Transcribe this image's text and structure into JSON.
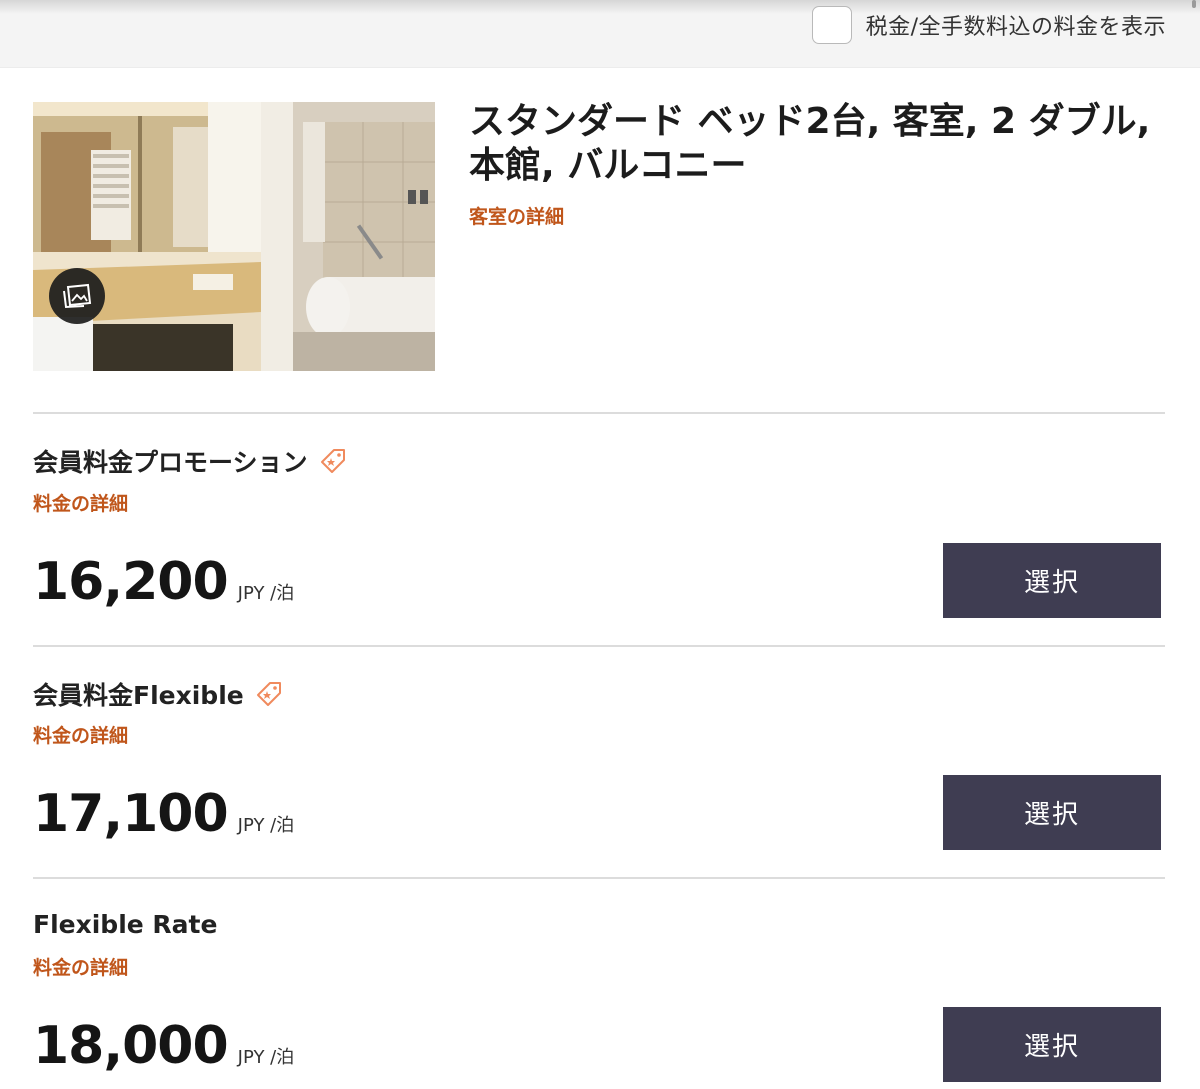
{
  "topbar": {
    "tax_toggle_label": "税金/全手数料込の料金を表示",
    "tax_toggle_checked": false
  },
  "room": {
    "title": "スタンダード ベッド2台, 客室, 2 ダブル, 本館, バルコニー",
    "details_link": "客室の詳細",
    "photo_icon": "gallery-icon"
  },
  "rates": [
    {
      "name": "会員料金プロモーション",
      "member_tag": true,
      "details_link": "料金の詳細",
      "price": "16,200",
      "unit": "JPY /泊",
      "select_label": "選択"
    },
    {
      "name": "会員料金Flexible",
      "member_tag": true,
      "details_link": "料金の詳細",
      "price": "17,100",
      "unit": "JPY /泊",
      "select_label": "選択"
    },
    {
      "name": "Flexible Rate",
      "member_tag": false,
      "details_link": "料金の詳細",
      "price": "18,000",
      "unit": "JPY /泊",
      "select_label": "選択"
    }
  ],
  "colors": {
    "accent_link": "#c0561b",
    "button_bg": "#3f3d52",
    "tag_icon": "#f08a5d"
  }
}
